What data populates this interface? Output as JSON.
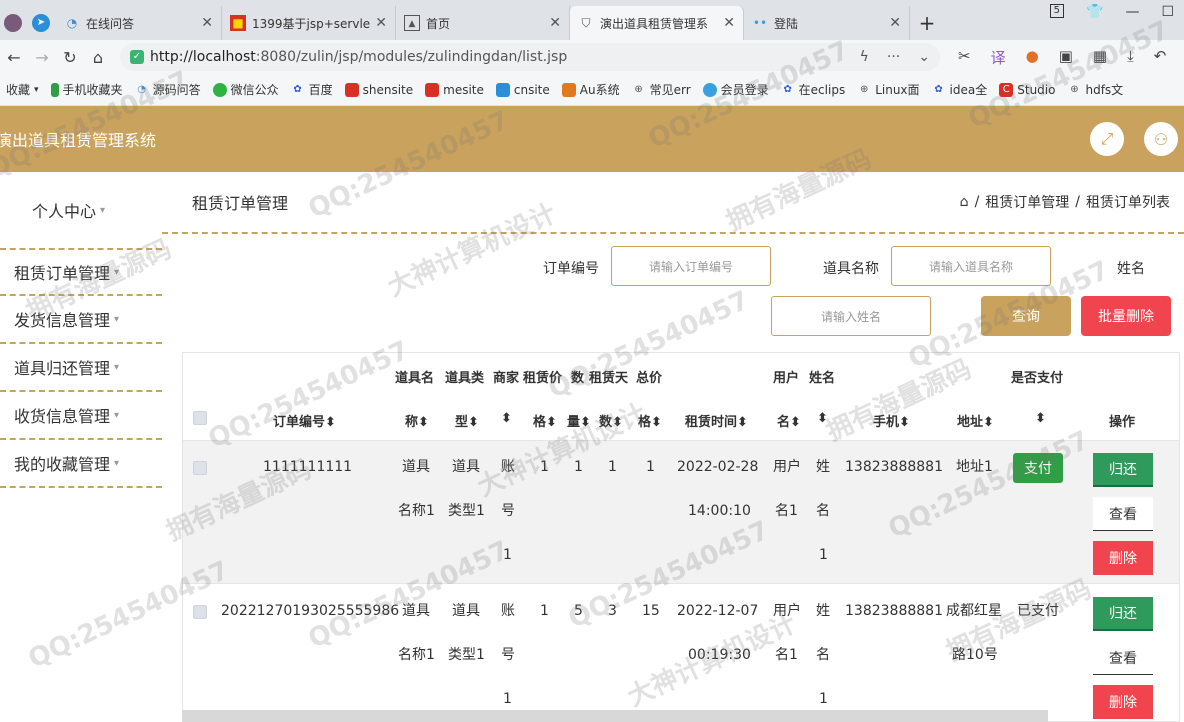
{
  "browser": {
    "tabs": [
      {
        "label": "在线问答",
        "icon": "swirl-icon"
      },
      {
        "label": "1399基于jsp+servle",
        "icon": "red-square-icon"
      },
      {
        "label": "首页",
        "icon": "picture-icon"
      },
      {
        "label": "演出道具租赁管理系",
        "icon": "shield-icon"
      },
      {
        "label": "登陆",
        "icon": "dots-icon"
      }
    ],
    "tab_count": "5",
    "url_host": "http://localhost",
    "url_path": ":8080/zulin/jsp/modules/zulindingdan/list.jsp",
    "bookmarks": [
      "收藏",
      "手机收藏夹",
      "源码问答",
      "微信公众",
      "百度",
      "shensite",
      "mesite",
      "cnsite",
      "Au系统",
      "常见err",
      "会员登录",
      "在eclips",
      "Linux面",
      "idea全",
      "Studio",
      "hdfs文"
    ]
  },
  "app": {
    "title": "演出道具租赁管理系统"
  },
  "sidebar": {
    "items": [
      {
        "label": "个人中心"
      },
      {
        "label": "租赁订单管理"
      },
      {
        "label": "发货信息管理"
      },
      {
        "label": "道具归还管理"
      },
      {
        "label": "收货信息管理"
      },
      {
        "label": "我的收藏管理"
      }
    ]
  },
  "main": {
    "page_title": "租赁订单管理",
    "breadcrumb": [
      "租赁订单管理",
      "租赁订单列表"
    ]
  },
  "search": {
    "order_no_label": "订单编号",
    "order_no_placeholder": "请输入订单编号",
    "prop_name_label": "道具名称",
    "prop_name_placeholder": "请输入道具名称",
    "name_label": "姓名",
    "name_placeholder": "请输入姓名",
    "query_button": "查询",
    "batch_delete_button": "批量删除"
  },
  "table": {
    "headers": {
      "order_no": "订单编号",
      "prop_name_1": "道具名",
      "prop_name_2": "称",
      "prop_type_1": "道具类",
      "prop_type_2": "型",
      "merchant": "商家",
      "merchant_2": "",
      "price_1": "租赁价",
      "price_2": "格",
      "qty_1": "数",
      "qty_2": "量",
      "days_1": "租赁天",
      "days_2": "数",
      "total_1": "总价",
      "total_2": "格",
      "rent_time": "租赁时间",
      "user_1": "用户",
      "user_2": "名",
      "name": "姓名",
      "phone": "手机",
      "address": "地址",
      "paid_1": "是否支付",
      "action": "操作"
    },
    "sort_icon": "⬍",
    "rows": [
      {
        "order_no": "1111111111",
        "prop_name": [
          "道具",
          "名称1"
        ],
        "prop_type": [
          "道具",
          "类型1"
        ],
        "merchant": [
          "账",
          "号",
          "1"
        ],
        "price": "1",
        "qty": "1",
        "days": "1",
        "total": "1",
        "rent_time": [
          "2022-02-28",
          "14:00:10"
        ],
        "user": [
          "用户",
          "名1"
        ],
        "name": [
          "姓",
          "名",
          "1"
        ],
        "phone": "13823888881",
        "address": [
          "地址1"
        ],
        "paid": "支付",
        "paid_is_button": true
      },
      {
        "order_no": "20221270193025555986",
        "prop_name": [
          "道具",
          "名称1"
        ],
        "prop_type": [
          "道具",
          "类型1"
        ],
        "merchant": [
          "账",
          "号",
          "1"
        ],
        "price": "1",
        "qty": "5",
        "days": "3",
        "total": "15",
        "rent_time": [
          "2022-12-07",
          "00:19:30"
        ],
        "user": [
          "用户",
          "名1"
        ],
        "name": [
          "姓",
          "名",
          "1"
        ],
        "phone": "13823888881",
        "address": [
          "成都红星",
          "路10号"
        ],
        "paid": "已支付",
        "paid_is_button": false
      }
    ],
    "actions": {
      "return": "归还",
      "view": "查看",
      "delete": "删除"
    }
  },
  "watermarks": [
    "QQ:254540457",
    "大神计算机设计",
    "拥有海量源码"
  ]
}
